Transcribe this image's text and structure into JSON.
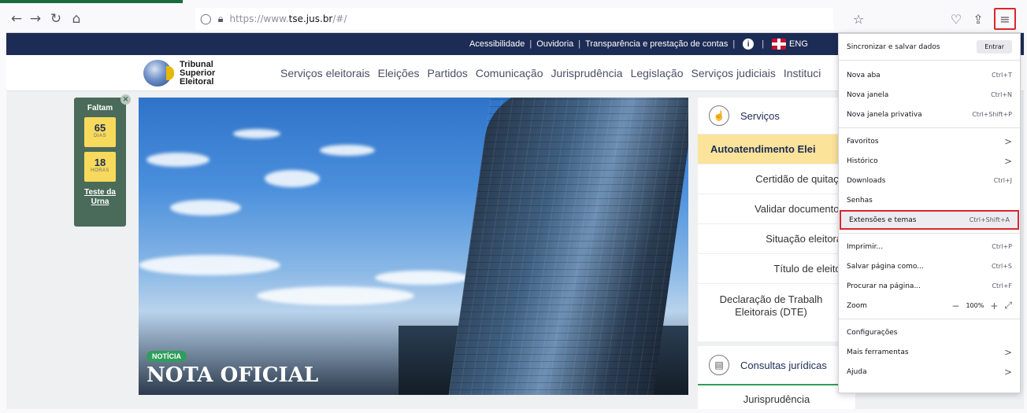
{
  "browser": {
    "url_prefix": "https://www.",
    "url_domain": "tse.jus.br",
    "url_suffix": "/#/"
  },
  "topbar": {
    "links": [
      "Acessibilidade",
      "Ouvidoria",
      "Transparência e prestação de contas"
    ],
    "lang": "ENG"
  },
  "logo": {
    "line1": "Tribunal",
    "line2": "Superior",
    "line3": "Eleitoral"
  },
  "nav": [
    "Serviços eleitorais",
    "Eleições",
    "Partidos",
    "Comunicação",
    "Jurisprudência",
    "Legislação",
    "Serviços judiciais",
    "Instituci"
  ],
  "countdown": {
    "title": "Faltam",
    "days_value": "65",
    "days_label": "DIAS",
    "hours_value": "18",
    "hours_label": "HORAS",
    "link_line1": "Teste da",
    "link_line2": "Urna"
  },
  "hero": {
    "badge": "NOTÍCIA",
    "title": "NOTA OFICIAL"
  },
  "services": {
    "title": "Serviços",
    "items": [
      "Autoatendimento Elei",
      "Certidão de quitaçã",
      "Validar documentos",
      "Situação eleitoral",
      "Título de eleitor",
      "Declaração de Trabalh",
      "Eleitorais (DTE)"
    ]
  },
  "consultas": {
    "title": "Consultas jurídicas",
    "sub": "Jurisprudência"
  },
  "menu": {
    "sync_label": "Sincronizar e salvar dados",
    "sync_button": "Entrar",
    "items": [
      {
        "label": "Nova aba",
        "shortcut": "Ctrl+T"
      },
      {
        "label": "Nova janela",
        "shortcut": "Ctrl+N"
      },
      {
        "label": "Nova janela privativa",
        "shortcut": "Ctrl+Shift+P"
      },
      {
        "label": "Favoritos",
        "shortcut": ">"
      },
      {
        "label": "Histórico",
        "shortcut": ">"
      },
      {
        "label": "Downloads",
        "shortcut": "Ctrl+J"
      },
      {
        "label": "Senhas",
        "shortcut": ""
      },
      {
        "label": "Extensões e temas",
        "shortcut": "Ctrl+Shift+A"
      },
      {
        "label": "Imprimir...",
        "shortcut": "Ctrl+P"
      },
      {
        "label": "Salvar página como...",
        "shortcut": "Ctrl+S"
      },
      {
        "label": "Procurar na página...",
        "shortcut": "Ctrl+F"
      },
      {
        "label": "Zoom",
        "shortcut": "100%"
      },
      {
        "label": "Configurações",
        "shortcut": ""
      },
      {
        "label": "Mais ferramentas",
        "shortcut": ">"
      },
      {
        "label": "Ajuda",
        "shortcut": ">"
      }
    ]
  },
  "colors": {
    "accent_red": "#d9272e",
    "navy": "#1d2c55",
    "green": "#2f9e5b",
    "yellow": "#fbe39a"
  }
}
